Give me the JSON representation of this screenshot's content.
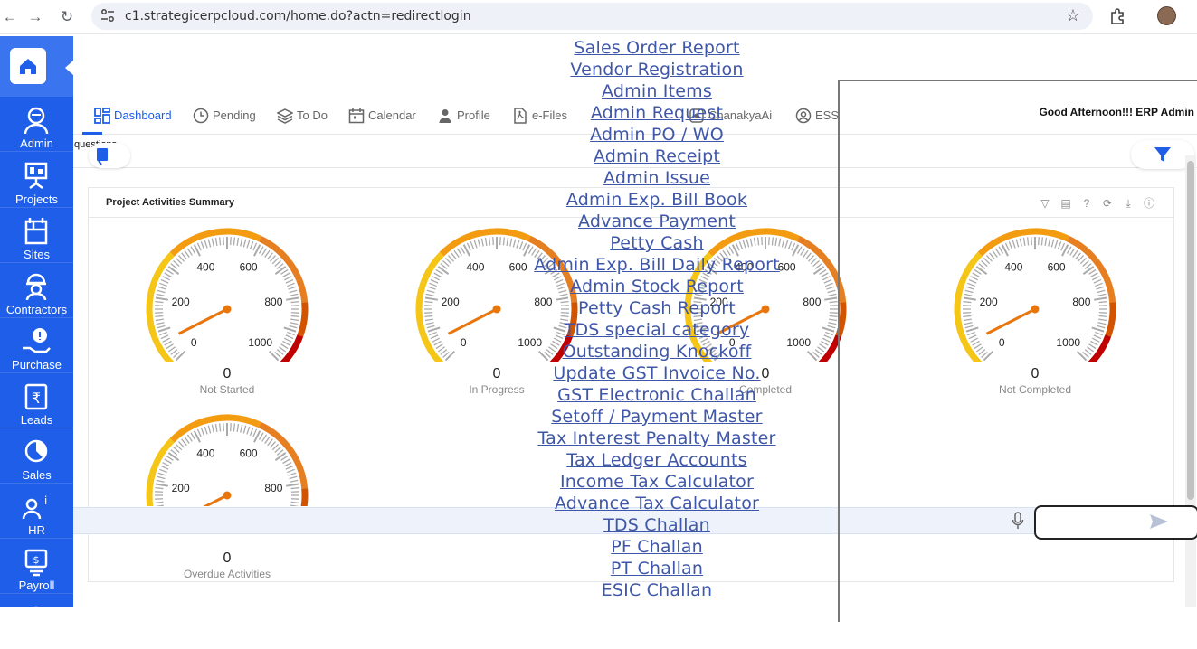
{
  "browser": {
    "url": "c1.strategicerpcloud.com/home.do?actn=redirectlogin"
  },
  "sidebar": {
    "items": [
      {
        "label": "Admin",
        "icon": "admin-icon"
      },
      {
        "label": "Projects",
        "icon": "projects-icon"
      },
      {
        "label": "Sites",
        "icon": "sites-icon"
      },
      {
        "label": "Contractors",
        "icon": "contractors-icon"
      },
      {
        "label": "Purchase",
        "icon": "purchase-icon"
      },
      {
        "label": "Leads",
        "icon": "leads-icon"
      },
      {
        "label": "Sales",
        "icon": "sales-icon"
      },
      {
        "label": "HR",
        "icon": "hr-icon"
      },
      {
        "label": "Payroll",
        "icon": "payroll-icon"
      }
    ]
  },
  "tabs": [
    {
      "label": "Dashboard",
      "icon": "dashboard-icon",
      "active": true
    },
    {
      "label": "Pending",
      "icon": "clock-icon"
    },
    {
      "label": "To Do",
      "icon": "layers-icon"
    },
    {
      "label": "Calendar",
      "icon": "calendar-icon"
    },
    {
      "label": "Profile",
      "icon": "user-icon"
    },
    {
      "label": "e-Files",
      "icon": "pdf-icon"
    },
    {
      "label": "ChanakyaAi",
      "icon": "ai-icon"
    },
    {
      "label": "ESS",
      "icon": "ess-icon"
    }
  ],
  "greeting": "Good Afternoon!!! ERP Admin",
  "questions_text": "questions.",
  "card": {
    "title": "Project Activities Summary",
    "gauges": [
      {
        "value": "0",
        "label": "Not Started",
        "ticks": [
          "0",
          "200",
          "400",
          "600",
          "800",
          "1000"
        ]
      },
      {
        "value": "0",
        "label": "In Progress",
        "ticks": [
          "0",
          "200",
          "400",
          "600",
          "800",
          "1000"
        ]
      },
      {
        "value": "0",
        "label": "Completed",
        "ticks": [
          "0",
          "200",
          "400",
          "600",
          "800",
          "1000"
        ]
      },
      {
        "value": "0",
        "label": "Not Completed",
        "ticks": [
          "0",
          "200",
          "400",
          "600",
          "800",
          "1000"
        ]
      },
      {
        "value": "0",
        "label": "Overdue Activities",
        "ticks": [
          "0",
          "200",
          "400",
          "600",
          "800",
          "1000"
        ]
      }
    ]
  },
  "menu": [
    "Sales Order Report",
    "Vendor Registration",
    "Admin Items",
    "Admin Request",
    "Admin PO / WO",
    "Admin Receipt",
    "Admin Issue",
    "Admin Exp. Bill Book",
    "Advance Payment",
    "Petty Cash",
    "Admin Exp. Bill Daily Report",
    "Admin Stock Report",
    "Petty Cash Report",
    "TDS special category",
    "Outstanding Knockoff",
    "Update GST Invoice No.",
    "GST Electronic Challan",
    "Setoff / Payment Master",
    "Tax Interest Penalty Master",
    "Tax Ledger Accounts",
    "Income Tax Calculator",
    "Advance Tax Calculator",
    "TDS Challan",
    "PF Challan",
    "PT Challan",
    "ESIC Challan"
  ],
  "colors": {
    "brand": "#1e5ee8",
    "link": "#3f57a8"
  }
}
